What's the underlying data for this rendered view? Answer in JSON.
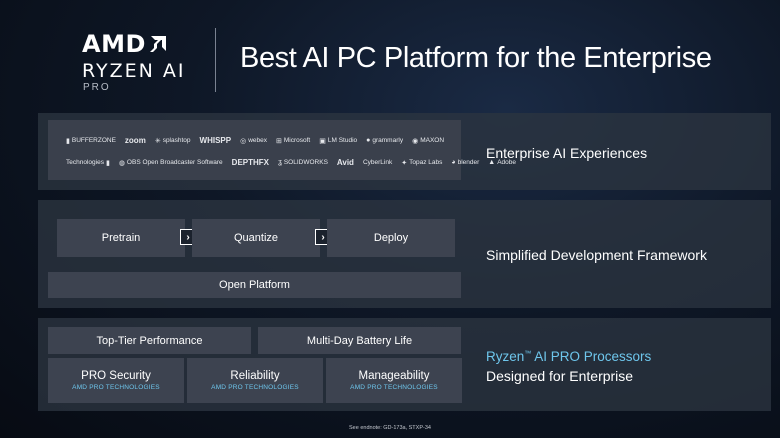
{
  "header": {
    "brand": "AMD",
    "product": "RYZEN AI",
    "tier": "PRO",
    "title": "Best AI PC Platform for the Enterprise"
  },
  "partners": {
    "row1": [
      "BUFFERZONE",
      "zoom",
      "splashtop",
      "WHISPP",
      "webex",
      "Microsoft",
      "LM Studio",
      "grammarly",
      "MAXON"
    ],
    "row2": [
      "Technologies",
      "OBS Open Broadcaster Software",
      "DEPTHFX",
      "SOLIDWORKS",
      "Avid",
      "CyberLink",
      "Topaz Labs",
      "blender",
      "Adobe"
    ]
  },
  "sections": {
    "experiences": "Enterprise AI Experiences",
    "framework": "Simplified Development Framework",
    "processors_line1_a": "Ryzen",
    "processors_line1_tm": "™",
    "processors_line1_b": " AI PRO Processors",
    "processors_line2": "Designed for Enterprise"
  },
  "workflow": {
    "steps": [
      "Pretrain",
      "Quantize",
      "Deploy"
    ],
    "arrow": "›",
    "platform": "Open Platform"
  },
  "features": {
    "performance": "Top-Tier Performance",
    "battery": "Multi-Day Battery Life",
    "cards": [
      {
        "title": "PRO Security",
        "sub": "AMD PRO TECHNOLOGIES"
      },
      {
        "title": "Reliability",
        "sub": "AMD PRO TECHNOLOGIES"
      },
      {
        "title": "Manageability",
        "sub": "AMD PRO TECHNOLOGIES"
      }
    ]
  },
  "footnote": "See endnote: GD-173a, STXP-34",
  "colors": {
    "accent": "#6ec6ec",
    "tile": "#3d4350",
    "band": "#2c3440"
  }
}
